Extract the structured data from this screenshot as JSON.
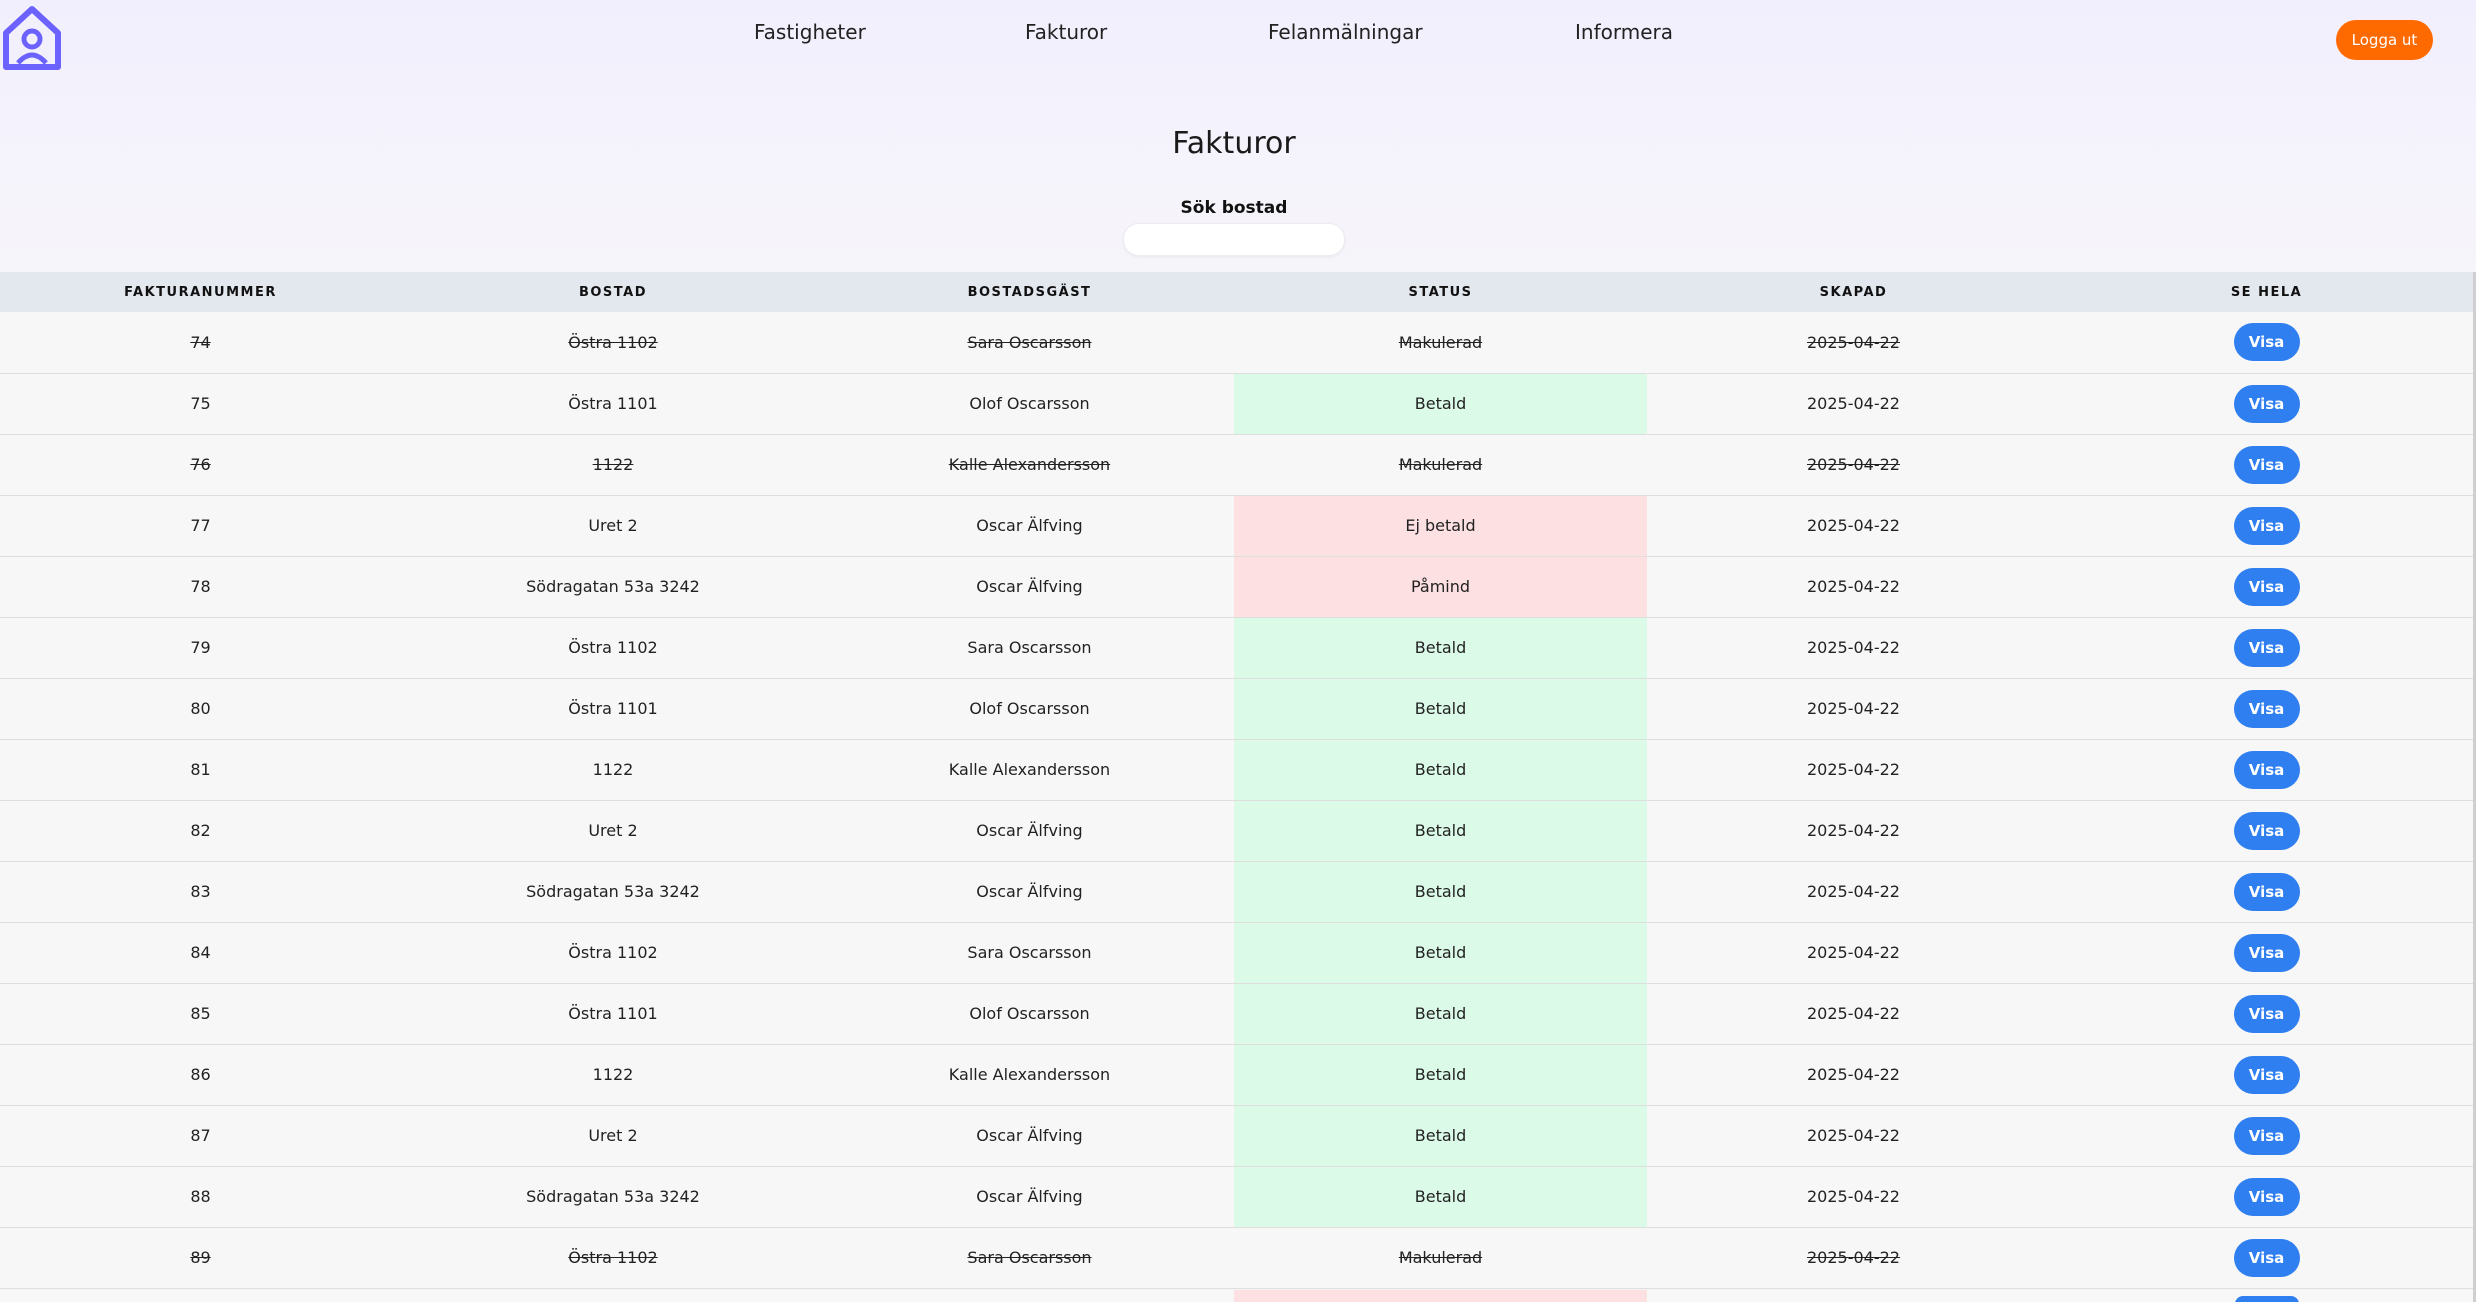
{
  "nav": {
    "items": [
      {
        "label": "Fastigheter"
      },
      {
        "label": "Fakturor"
      },
      {
        "label": "Felanmälningar"
      },
      {
        "label": "Informera"
      }
    ],
    "logout_label": "Logga ut"
  },
  "colors": {
    "accent_logo": "#6c63ff",
    "logout": "#ff6a00",
    "button": "#2f7ff0",
    "status_paid": "#dcfae8",
    "status_unpaid": "#fde1e2"
  },
  "page": {
    "title": "Fakturor",
    "search_label": "Sök bostad",
    "search_value": ""
  },
  "table": {
    "headers": [
      "FAKTURANUMMER",
      "BOSTAD",
      "BOSTADSGÄST",
      "STATUS",
      "SKAPAD",
      "SE HELA"
    ],
    "button_label": "Visa",
    "rows": [
      {
        "nr": "74",
        "bostad": "Östra 1102",
        "gast": "Sara Oscarsson",
        "status": "Makulerad",
        "skapad": "2025-04-22",
        "struck": true
      },
      {
        "nr": "75",
        "bostad": "Östra 1101",
        "gast": "Olof Oscarsson",
        "status": "Betald",
        "skapad": "2025-04-22",
        "struck": false
      },
      {
        "nr": "76",
        "bostad": "1122",
        "gast": "Kalle Alexandersson",
        "status": "Makulerad",
        "skapad": "2025-04-22",
        "struck": true
      },
      {
        "nr": "77",
        "bostad": "Uret 2",
        "gast": "Oscar Älfving",
        "status": "Ej betald",
        "skapad": "2025-04-22",
        "struck": false
      },
      {
        "nr": "78",
        "bostad": "Södragatan 53a 3242",
        "gast": "Oscar Älfving",
        "status": "Påmind",
        "skapad": "2025-04-22",
        "struck": false
      },
      {
        "nr": "79",
        "bostad": "Östra 1102",
        "gast": "Sara Oscarsson",
        "status": "Betald",
        "skapad": "2025-04-22",
        "struck": false
      },
      {
        "nr": "80",
        "bostad": "Östra 1101",
        "gast": "Olof Oscarsson",
        "status": "Betald",
        "skapad": "2025-04-22",
        "struck": false
      },
      {
        "nr": "81",
        "bostad": "1122",
        "gast": "Kalle Alexandersson",
        "status": "Betald",
        "skapad": "2025-04-22",
        "struck": false
      },
      {
        "nr": "82",
        "bostad": "Uret 2",
        "gast": "Oscar Älfving",
        "status": "Betald",
        "skapad": "2025-04-22",
        "struck": false
      },
      {
        "nr": "83",
        "bostad": "Södragatan 53a 3242",
        "gast": "Oscar Älfving",
        "status": "Betald",
        "skapad": "2025-04-22",
        "struck": false
      },
      {
        "nr": "84",
        "bostad": "Östra 1102",
        "gast": "Sara Oscarsson",
        "status": "Betald",
        "skapad": "2025-04-22",
        "struck": false
      },
      {
        "nr": "85",
        "bostad": "Östra 1101",
        "gast": "Olof Oscarsson",
        "status": "Betald",
        "skapad": "2025-04-22",
        "struck": false
      },
      {
        "nr": "86",
        "bostad": "1122",
        "gast": "Kalle Alexandersson",
        "status": "Betald",
        "skapad": "2025-04-22",
        "struck": false
      },
      {
        "nr": "87",
        "bostad": "Uret 2",
        "gast": "Oscar Älfving",
        "status": "Betald",
        "skapad": "2025-04-22",
        "struck": false
      },
      {
        "nr": "88",
        "bostad": "Södragatan 53a 3242",
        "gast": "Oscar Älfving",
        "status": "Betald",
        "skapad": "2025-04-22",
        "struck": false
      },
      {
        "nr": "89",
        "bostad": "Östra 1102",
        "gast": "Sara Oscarsson",
        "status": "Makulerad",
        "skapad": "2025-04-22",
        "struck": true
      }
    ]
  }
}
